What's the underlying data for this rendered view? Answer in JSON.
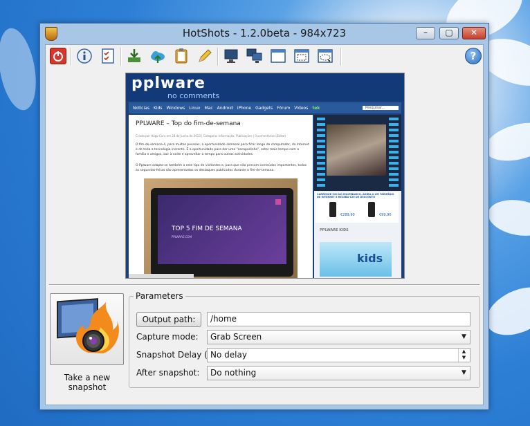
{
  "window": {
    "title": "HotShots - 1.2.0beta - 984x723",
    "minimize": "–",
    "maximize": "▢",
    "close": "✕"
  },
  "toolbar": {
    "buttons": [
      "power-icon",
      "info-icon",
      "checklist-icon",
      "save-icon",
      "upload-icon",
      "clipboard-icon",
      "edit-icon",
      "screen-icon",
      "multi-screen-icon",
      "window-icon",
      "region-icon",
      "freehand-icon",
      "help-icon"
    ],
    "help_label": "?"
  },
  "preview": {
    "site_logo": "pplware",
    "site_tagline": "no comments",
    "nav": [
      "Notícias",
      "Kids",
      "Windows",
      "Linux",
      "Mac",
      "Android",
      "iPhone",
      "Gadgets",
      "Fórum",
      "Vídeos",
      "tek"
    ],
    "search_placeholder": "Pesquisar...",
    "post_title": "PPLWARE – Top do fim-de-semana",
    "post_meta": "Criado por Hugo Cura em 24 de Junho de 2013 | Categoria: Informação, Publicações | 0 comentários (Editar)",
    "post_text_1": "O fim-de-semana é, para muitas pessoas, a oportunidade semanal para ficar longe do computador, da Internet e de toda a tecnologia inerente. É a oportunidade para dar uma \"escapadinha\", estar mais tempo com a família e amigos, sair à noite e aproveitar o tempo para outras actividades.",
    "post_text_2": "O Pplware adapta-se também a este tipo de visitantes e, para que não percam conteúdos importantes, todas as segundas-feiras são apresentados os destaques publicados durante o fim-de-semana.",
    "tablet_text": "TOP 5 FIM DE SEMANA",
    "tablet_sub": "PPLWARE.COM",
    "ad_text": "CARREGUE €20 NO MULTIBANCO, ADIRA A UM TARIFÁRIO DE INTERNET E RECEBA €20 DE DESCONTO",
    "ad_price_1": "€289,90",
    "ad_price_2": "€99,90",
    "kids_heading": "PPLWARE KIDS",
    "kids_logo": "kids"
  },
  "snapshot": {
    "label": "Take a new snapshot"
  },
  "parameters": {
    "legend": "Parameters",
    "output_button": "Output path:",
    "output_value": "/home",
    "capture_label": "Capture mode:",
    "capture_value": "Grab Screen",
    "delay_label": "Snapshot Delay (s):",
    "delay_value": "No delay",
    "after_label": "After snapshot:",
    "after_value": "Do nothing"
  }
}
